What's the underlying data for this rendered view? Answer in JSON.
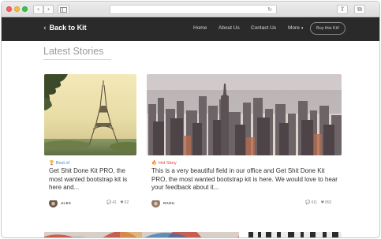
{
  "browser": {
    "nav_back": "‹",
    "nav_forward": "›",
    "sidebar_icon": "sidebar-icon",
    "reload_icon": "↻",
    "share_icon": "⇪",
    "tabs_icon": "⧉"
  },
  "navbar": {
    "brand_label": "Back to Kit",
    "brand_icon": "chevron-left-icon",
    "links": [
      "Home",
      "About Us",
      "Contact Us",
      "More"
    ],
    "more_caret": "▾",
    "buy_button": "Buy this Kit!"
  },
  "main": {
    "section_title": "Latest Stories",
    "cards": [
      {
        "category": "Best of",
        "category_icon": "trophy-icon",
        "category_color": "#2f8fd8",
        "description": "Get Shit Done Kit PRO, the most wanted bootstrap kit is here and...",
        "author": "ALEX",
        "comments": "41",
        "likes": "92"
      },
      {
        "category": "Hot Story",
        "category_icon": "fire-icon",
        "category_color": "#e23c3c",
        "description": "This is a very beautiful field in our office and Get Shit Done Kit PRO, the most wanted bootstrap kit is here. We would love to hear your feedback about it...",
        "author": "RADU",
        "comments": "411",
        "likes": "892"
      }
    ]
  },
  "colors": {
    "navbar_bg": "#2a2a2a",
    "accent_blue": "#2f8fd8",
    "accent_red": "#e23c3c"
  }
}
